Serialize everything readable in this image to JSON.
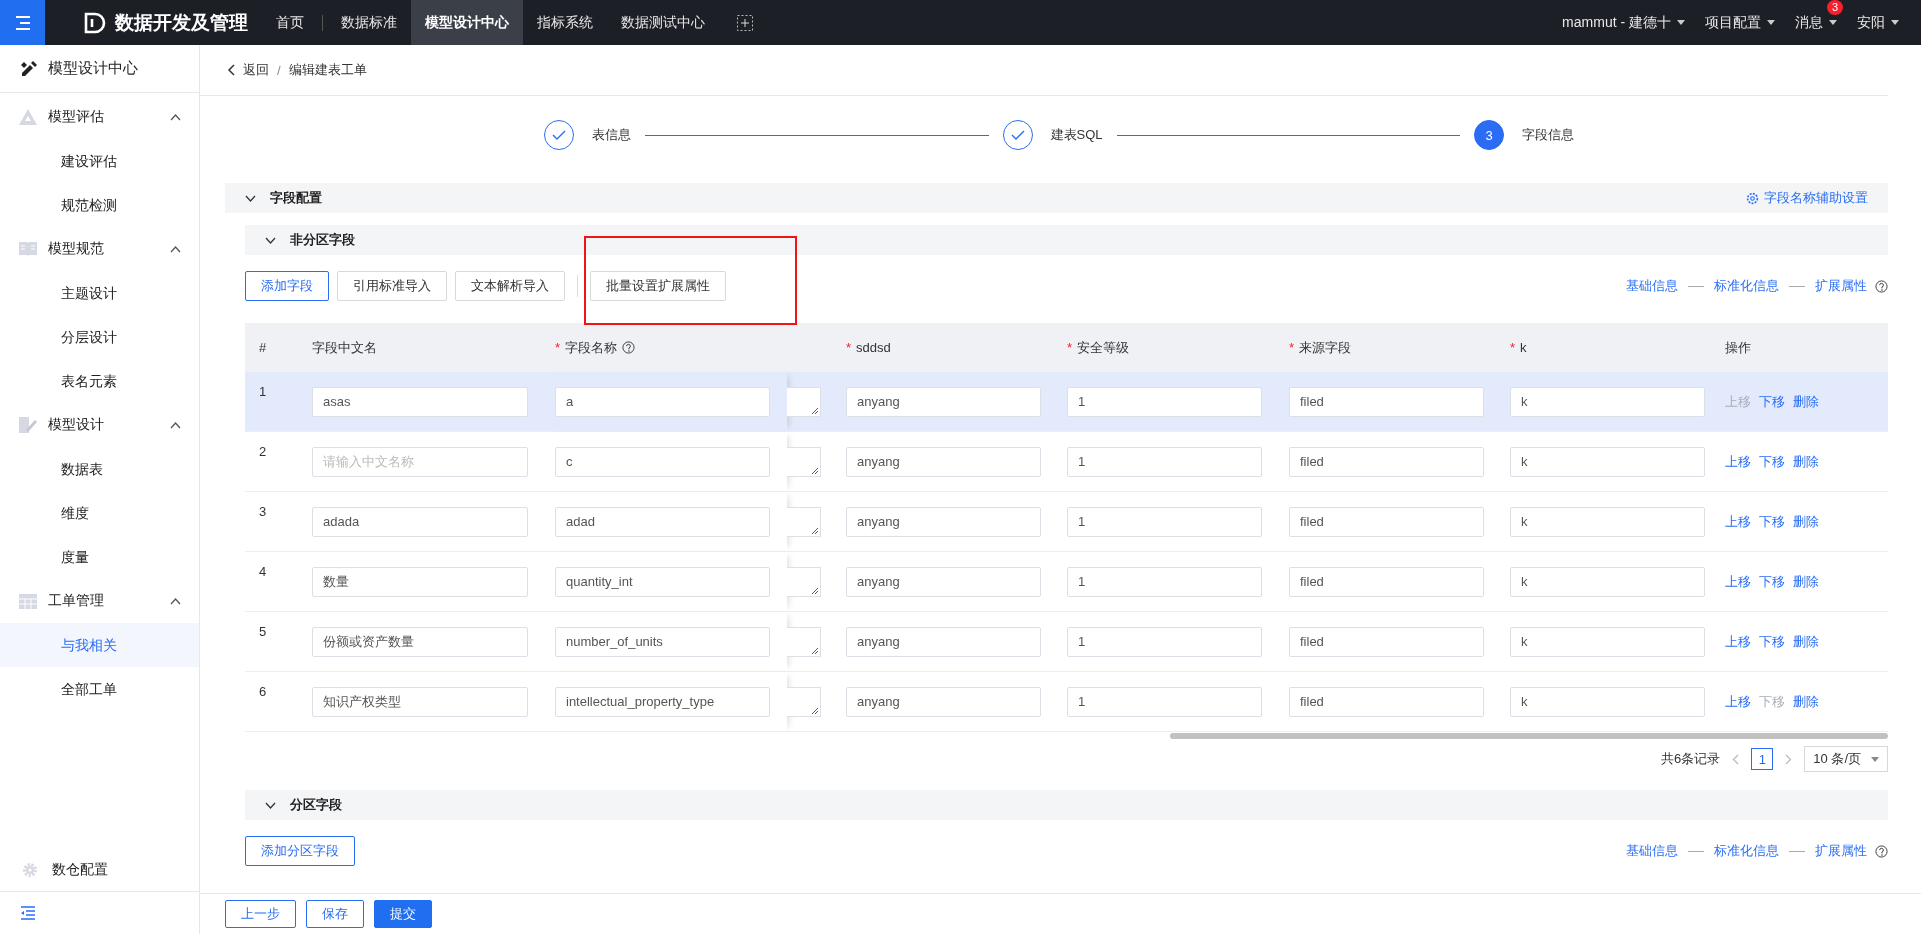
{
  "top_nav": {
    "brand": "数据开发及管理",
    "items": [
      {
        "label": "首页",
        "selected": false
      },
      {
        "label": "数据标准",
        "selected": false
      },
      {
        "label": "模型设计中心",
        "selected": true
      },
      {
        "label": "指标系统",
        "selected": false
      },
      {
        "label": "数据测试中心",
        "selected": false
      }
    ],
    "menus": [
      {
        "label": "mammut - 建德十"
      },
      {
        "label": "项目配置"
      },
      {
        "label": "消息",
        "badge": "3"
      },
      {
        "label": "安阳"
      }
    ]
  },
  "sidebar": {
    "title": "模型设计中心",
    "groups": [
      {
        "label": "模型评估",
        "expanded": true,
        "children": [
          {
            "label": "建设评估",
            "selected": false
          },
          {
            "label": "规范检测",
            "selected": false
          }
        ]
      },
      {
        "label": "模型规范",
        "expanded": true,
        "children": [
          {
            "label": "主题设计",
            "selected": false
          },
          {
            "label": "分层设计",
            "selected": false
          },
          {
            "label": "表名元素",
            "selected": false
          }
        ]
      },
      {
        "label": "模型设计",
        "expanded": true,
        "children": [
          {
            "label": "数据表",
            "selected": false
          },
          {
            "label": "维度",
            "selected": false
          },
          {
            "label": "度量",
            "selected": false
          }
        ]
      },
      {
        "label": "工单管理",
        "expanded": true,
        "children": [
          {
            "label": "与我相关",
            "selected": true
          },
          {
            "label": "全部工单",
            "selected": false
          }
        ]
      }
    ],
    "bottom_item": "数仓配置"
  },
  "breadcrumb": {
    "back": "返回",
    "separator": "/",
    "current": "编辑建表工单"
  },
  "steps": [
    {
      "label": "表信息",
      "completed": true
    },
    {
      "label": "建表SQL",
      "completed": true
    },
    {
      "label": "字段信息",
      "completed": false,
      "number": "3"
    }
  ],
  "section": {
    "title": "字段配置",
    "expanded": true,
    "action": "字段名称辅助设置"
  },
  "non_partition": {
    "title": "非分区字段",
    "expanded": true,
    "buttons": [
      {
        "label": "添加字段",
        "kind": "outline"
      },
      {
        "label": "引用标准导入",
        "kind": "default"
      },
      {
        "label": "文本解析导入",
        "kind": "default"
      },
      {
        "label": "批量设置扩展属性",
        "kind": "default",
        "annotated": true
      }
    ],
    "view_links": [
      "基础信息",
      "标准化信息",
      "扩展属性"
    ],
    "table": {
      "required_mark": "*",
      "columns": [
        {
          "label": "#",
          "required": false
        },
        {
          "label": "字段中文名",
          "required": false
        },
        {
          "label": "字段名称",
          "required": true
        },
        {
          "label": "sddsd",
          "required": true
        },
        {
          "label": "安全等级",
          "required": true
        },
        {
          "label": "来源字段",
          "required": true
        },
        {
          "label": "k",
          "required": true
        },
        {
          "label": "操作",
          "required": false
        }
      ],
      "rows": [
        {
          "index": "1",
          "cn_name": "asas",
          "name": "a",
          "sddsd": "anyang",
          "level": "1",
          "source": "filed",
          "k": "k",
          "highlighted": true,
          "actions": [
            {
              "label": "上移",
              "disabled": true
            },
            {
              "label": "下移",
              "disabled": false
            },
            {
              "label": "删除",
              "disabled": false
            }
          ]
        },
        {
          "index": "2",
          "cn_placeholder": "请输入中文名称",
          "name": "c",
          "sddsd": "anyang",
          "level": "1",
          "source": "filed",
          "k": "k",
          "highlighted": false,
          "actions": [
            {
              "label": "上移",
              "disabled": false
            },
            {
              "label": "下移",
              "disabled": false
            },
            {
              "label": "删除",
              "disabled": false
            }
          ]
        },
        {
          "index": "3",
          "cn_name": "adada",
          "name": "adad",
          "sddsd": "anyang",
          "level": "1",
          "source": "filed",
          "k": "k",
          "highlighted": false,
          "actions": [
            {
              "label": "上移",
              "disabled": false
            },
            {
              "label": "下移",
              "disabled": false
            },
            {
              "label": "删除",
              "disabled": false
            }
          ]
        },
        {
          "index": "4",
          "cn_name": "数量",
          "name": "quantity_int",
          "sddsd": "anyang",
          "level": "1",
          "source": "filed",
          "k": "k",
          "highlighted": false,
          "actions": [
            {
              "label": "上移",
              "disabled": false
            },
            {
              "label": "下移",
              "disabled": false
            },
            {
              "label": "删除",
              "disabled": false
            }
          ]
        },
        {
          "index": "5",
          "cn_name": "份额或资产数量",
          "name": "number_of_units",
          "sddsd": "anyang",
          "level": "1",
          "source": "filed",
          "k": "k",
          "highlighted": false,
          "actions": [
            {
              "label": "上移",
              "disabled": false
            },
            {
              "label": "下移",
              "disabled": false
            },
            {
              "label": "删除",
              "disabled": false
            }
          ]
        },
        {
          "index": "6",
          "cn_name": "知识产权类型",
          "name": "intellectual_property_type",
          "sddsd": "anyang",
          "level": "1",
          "source": "filed",
          "k": "k",
          "highlighted": false,
          "actions": [
            {
              "label": "上移",
              "disabled": false
            },
            {
              "label": "下移",
              "disabled": true
            },
            {
              "label": "删除",
              "disabled": false
            }
          ]
        }
      ]
    },
    "pagination": {
      "total": "共6条记录",
      "pages": [
        {
          "label": "1",
          "selected": true
        }
      ],
      "page_size": "10 条/页"
    }
  },
  "partition": {
    "title": "分区字段",
    "expanded": true,
    "buttons": [
      {
        "label": "添加分区字段",
        "kind": "outline"
      }
    ],
    "view_links": [
      "基础信息",
      "标准化信息",
      "扩展属性"
    ]
  },
  "footer_buttons": [
    {
      "label": "上一步",
      "kind": "outline"
    },
    {
      "label": "保存",
      "kind": "outline"
    },
    {
      "label": "提交",
      "kind": "solid"
    }
  ]
}
